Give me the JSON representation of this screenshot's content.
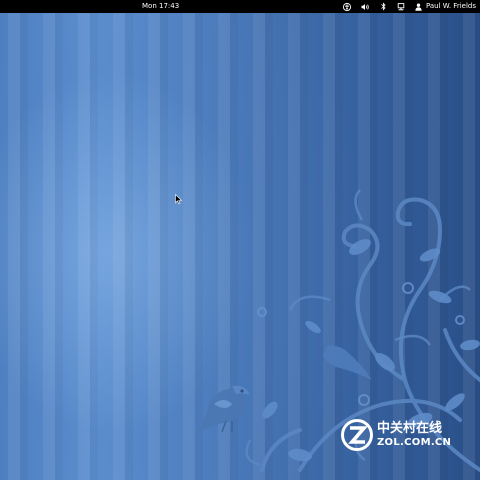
{
  "top_bar": {
    "clock": "Mon 17:43",
    "status_icons": [
      "accessibility-icon",
      "volume-icon",
      "bluetooth-icon",
      "network-icon"
    ],
    "user_menu": {
      "icon": "user-icon",
      "name": "Paul W. Frields"
    }
  },
  "desktop": {
    "wallpaper": "Fedora 17 Beefy Miracle blue striped wallpaper with vines and birds",
    "cursor": "arrow-pointer"
  },
  "watermark": {
    "logo_letter": "Z",
    "chinese_text": "中关村在线",
    "url_text": "ZOL.COM.CN"
  },
  "colors": {
    "top_bar": "#000000",
    "wallpaper_light": "#6f9fd8",
    "wallpaper_dark": "#2a4f88",
    "vine": "#5a86c2",
    "text": "#ffffff"
  }
}
